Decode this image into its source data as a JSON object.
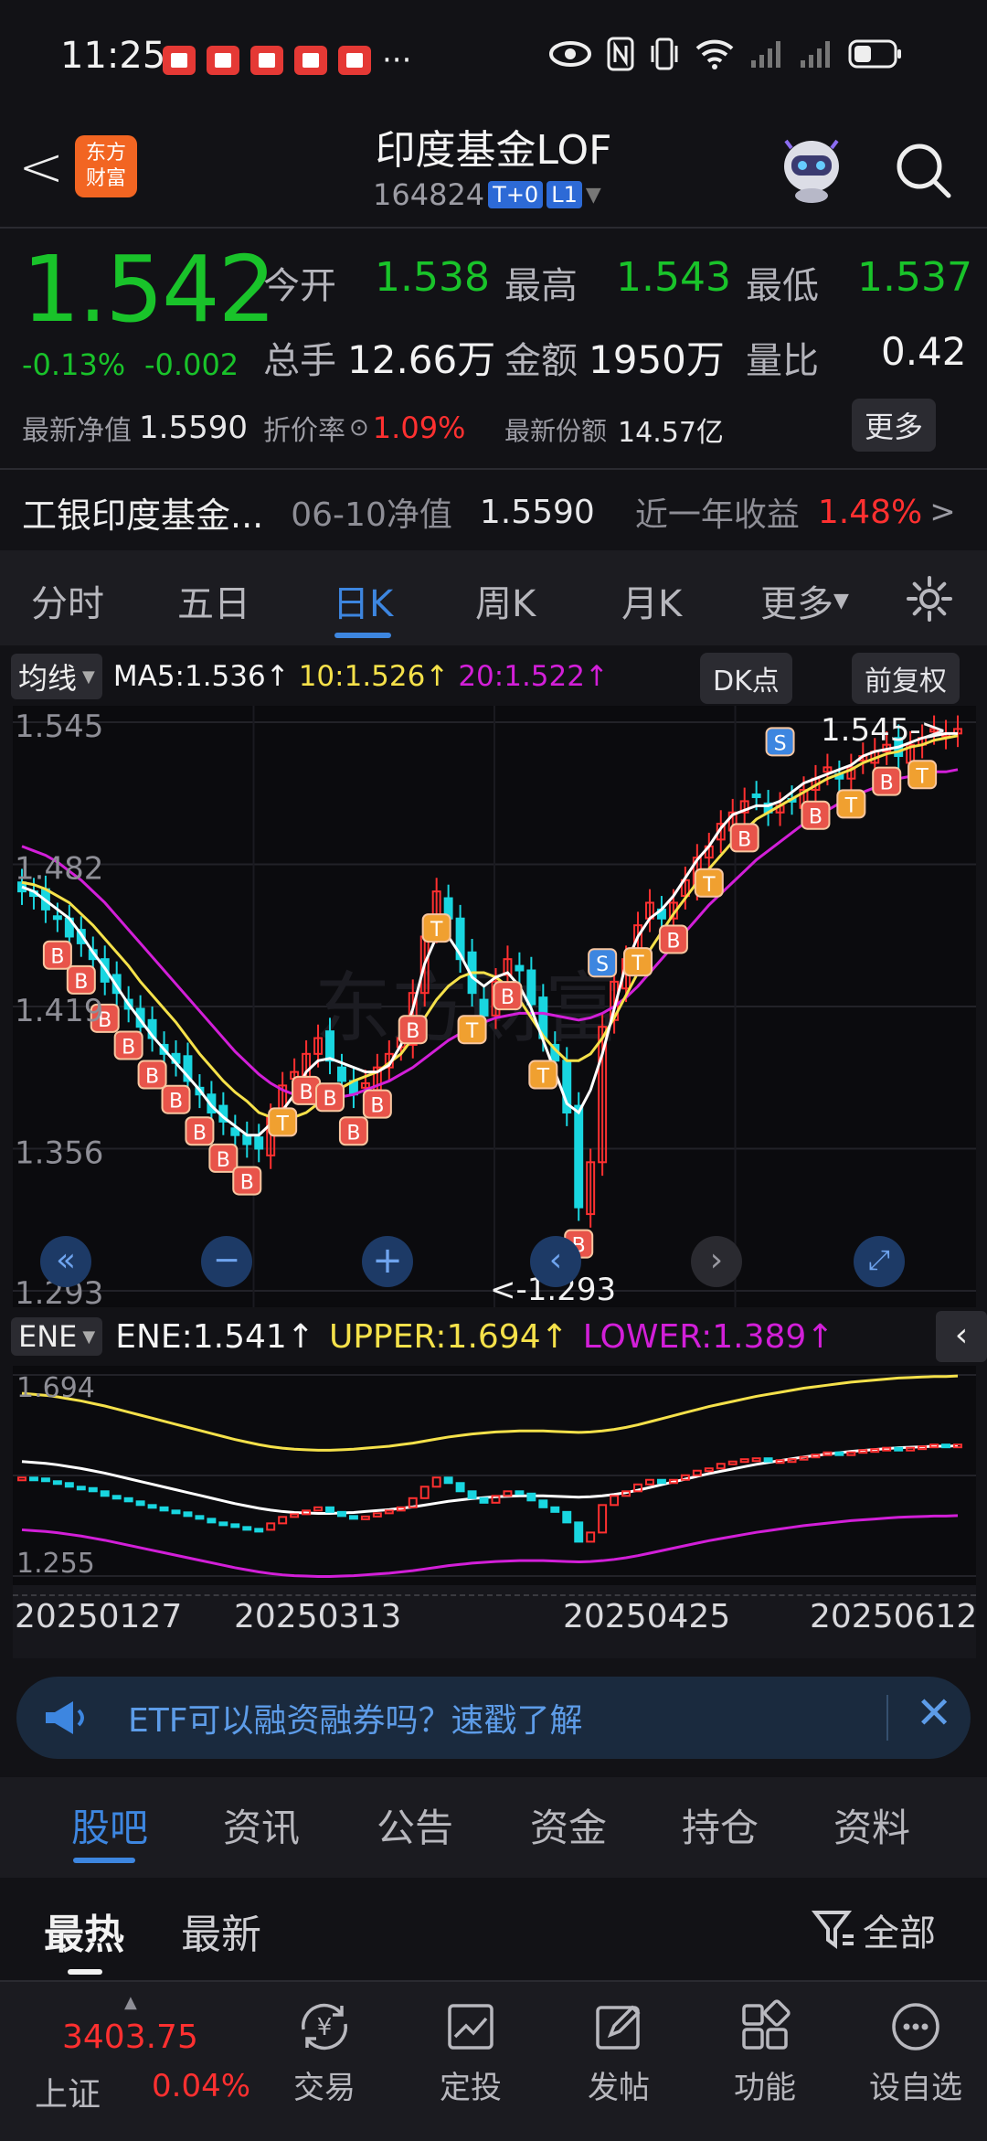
{
  "status_bar": {
    "time": "11:25",
    "dots": "···"
  },
  "header": {
    "back": "<",
    "logo_line1": "东方",
    "logo_line2": "财富",
    "title": "印度基金LOF",
    "code": "164824",
    "badge1": "T+0",
    "badge2": "L1"
  },
  "quote": {
    "price": "1.542",
    "change_pct": "-0.13%",
    "change_abs": "-0.002",
    "open_label": "今开",
    "open": "1.538",
    "high_label": "最高",
    "high": "1.543",
    "low_label": "最低",
    "low": "1.537",
    "vol_label": "总手",
    "vol": "12.66万",
    "amt_label": "金额",
    "amt": "1950万",
    "ratio_label": "量比",
    "ratio": "0.42",
    "nav_label": "最新净值",
    "nav": "1.5590",
    "discount_label": "折价率",
    "discount": "1.09%",
    "share_label": "最新份额",
    "share": "14.57亿",
    "more": "更多"
  },
  "fund_row": {
    "name": "工银印度基金...",
    "nav_date_label": "06-10净值",
    "nav_value": "1.5590",
    "yield_label": "近一年收益",
    "yield": "1.48%",
    "arrow": ">"
  },
  "chart_tabs": [
    "分时",
    "五日",
    "日K",
    "周K",
    "月K",
    "更多"
  ],
  "active_tab": 2,
  "ma_bar": {
    "selector": "均线",
    "ma5": "MA5:1.536↑",
    "ma10": "10:1.526↑",
    "ma20": "20:1.522↑",
    "dk": "DK点",
    "adjust": "前复权"
  },
  "chart_data": {
    "type": "candlestick",
    "y_ticks": [
      "1.545",
      "1.482",
      "1.419",
      "1.356",
      "1.293"
    ],
    "ylim": [
      1.293,
      1.545
    ],
    "high_label": "1.545->",
    "low_label": "<-1.293",
    "x_labels": [
      "20250127",
      "20250313",
      "20250425",
      "20250612"
    ],
    "close": [
      1.47,
      1.468,
      1.462,
      1.458,
      1.45,
      1.447,
      1.44,
      1.43,
      1.425,
      1.418,
      1.41,
      1.405,
      1.398,
      1.394,
      1.386,
      1.38,
      1.372,
      1.368,
      1.362,
      1.358,
      1.356,
      1.37,
      1.384,
      1.39,
      1.398,
      1.405,
      1.395,
      1.386,
      1.38,
      1.385,
      1.392,
      1.398,
      1.405,
      1.425,
      1.45,
      1.47,
      1.458,
      1.44,
      1.425,
      1.415,
      1.43,
      1.44,
      1.435,
      1.42,
      1.405,
      1.395,
      1.372,
      1.33,
      1.35,
      1.41,
      1.43,
      1.44,
      1.455,
      1.465,
      1.458,
      1.465,
      1.475,
      1.485,
      1.49,
      1.5,
      1.505,
      1.51,
      1.512,
      1.505,
      1.508,
      1.51,
      1.515,
      1.52,
      1.525,
      1.52,
      1.525,
      1.53,
      1.532,
      1.535,
      1.53,
      1.535,
      1.538,
      1.542,
      1.54,
      1.542
    ],
    "ma5": [
      1.472,
      1.47,
      1.466,
      1.462,
      1.458,
      1.451,
      1.443,
      1.436,
      1.428,
      1.42,
      1.413,
      1.406,
      1.4,
      1.394,
      1.388,
      1.382,
      1.375,
      1.37,
      1.366,
      1.362,
      1.362,
      1.367,
      1.373,
      1.38,
      1.39,
      1.395,
      1.396,
      1.394,
      1.392,
      1.39,
      1.39,
      1.393,
      1.402,
      1.418,
      1.438,
      1.45,
      1.45,
      1.442,
      1.432,
      1.428,
      1.432,
      1.434,
      1.428,
      1.418,
      1.404,
      1.39,
      1.376,
      1.372,
      1.382,
      1.398,
      1.418,
      1.438,
      1.45,
      1.458,
      1.462,
      1.468,
      1.476,
      1.484,
      1.49,
      1.498,
      1.504,
      1.506,
      1.508,
      1.508,
      1.51,
      1.514,
      1.518,
      1.52,
      1.522,
      1.524,
      1.526,
      1.53,
      1.532,
      1.533,
      1.534,
      1.536,
      1.538,
      1.539,
      1.54,
      1.54
    ],
    "ma10": [
      1.474,
      1.473,
      1.471,
      1.468,
      1.465,
      1.46,
      1.455,
      1.449,
      1.443,
      1.437,
      1.43,
      1.424,
      1.418,
      1.412,
      1.405,
      1.398,
      1.392,
      1.386,
      1.381,
      1.377,
      1.372,
      1.37,
      1.369,
      1.37,
      1.372,
      1.376,
      1.38,
      1.383,
      1.386,
      1.388,
      1.39,
      1.394,
      1.398,
      1.405,
      1.414,
      1.422,
      1.428,
      1.432,
      1.434,
      1.434,
      1.432,
      1.428,
      1.422,
      1.414,
      1.406,
      1.4,
      1.395,
      1.395,
      1.398,
      1.405,
      1.414,
      1.424,
      1.434,
      1.444,
      1.452,
      1.46,
      1.467,
      1.474,
      1.48,
      1.486,
      1.492,
      1.497,
      1.502,
      1.505,
      1.508,
      1.511,
      1.514,
      1.517,
      1.52,
      1.522,
      1.524,
      1.527,
      1.529,
      1.531,
      1.532,
      1.534,
      1.535,
      1.537,
      1.538,
      1.539
    ],
    "ma20": [
      1.49,
      1.488,
      1.486,
      1.483,
      1.479,
      1.475,
      1.47,
      1.465,
      1.459,
      1.453,
      1.447,
      1.441,
      1.435,
      1.429,
      1.423,
      1.417,
      1.411,
      1.405,
      1.399,
      1.394,
      1.389,
      1.385,
      1.382,
      1.38,
      1.379,
      1.378,
      1.378,
      1.379,
      1.38,
      1.382,
      1.384,
      1.386,
      1.389,
      1.392,
      1.396,
      1.4,
      1.404,
      1.407,
      1.41,
      1.412,
      1.414,
      1.415,
      1.416,
      1.416,
      1.416,
      1.415,
      1.414,
      1.413,
      1.414,
      1.416,
      1.419,
      1.423,
      1.428,
      1.434,
      1.44,
      1.446,
      1.452,
      1.458,
      1.464,
      1.469,
      1.474,
      1.479,
      1.484,
      1.488,
      1.492,
      1.496,
      1.5,
      1.503,
      1.506,
      1.509,
      1.512,
      1.514,
      1.516,
      1.518,
      1.52,
      1.521,
      1.522,
      1.523,
      1.523,
      1.524
    ],
    "ene": {
      "selector": "ENE",
      "ene": "ENE:1.541↑",
      "upper": "UPPER:1.694↑",
      "lower": "LOWER:1.389↑",
      "y_top": "1.694",
      "y_bottom": "1.255"
    }
  },
  "banner": {
    "text": "ETF可以融资融券吗？速戳了解"
  },
  "section_tabs": [
    "股吧",
    "资讯",
    "公告",
    "资金",
    "持仓",
    "资料"
  ],
  "sub_tabs": {
    "hot": "最热",
    "new": "最新",
    "filter": "全部"
  },
  "bottom_bar": {
    "index_value": "3403.75",
    "index_name": "上证",
    "index_change": "0.04%",
    "items": [
      "交易",
      "定投",
      "发帖",
      "功能",
      "设自选"
    ]
  },
  "colors": {
    "up": "#ff3030",
    "down": "#19c32a",
    "accent": "#3d86e0",
    "ma5": "#ffffff",
    "ma10": "#f5e14a",
    "ma20": "#d21fd8"
  }
}
